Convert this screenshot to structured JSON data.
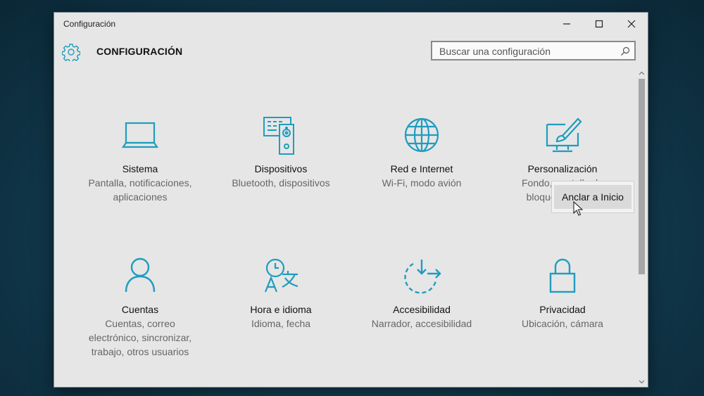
{
  "window": {
    "title": "Configuración",
    "controls": {
      "minimize": "minimize",
      "maximize": "maximize",
      "close": "close"
    }
  },
  "header": {
    "title": "CONFIGURACIÓN",
    "search_placeholder": "Buscar una configuración"
  },
  "accent_color": "#1e9dbf",
  "categories": [
    {
      "name": "Sistema",
      "desc_lines": [
        "Pantalla, notificaciones,",
        "aplicaciones"
      ],
      "icon": "laptop-icon"
    },
    {
      "name": "Dispositivos",
      "desc_lines": [
        "Bluetooth, dispositivos"
      ],
      "icon": "devices-icon"
    },
    {
      "name": "Red e Internet",
      "desc_lines": [
        "Wi-Fi, modo avión"
      ],
      "icon": "globe-icon"
    },
    {
      "name": "Personalización",
      "desc_lines": [
        "Fondo, pantalla de",
        "bloqueo, colores"
      ],
      "icon": "paintbrush-icon"
    },
    {
      "name": "Cuentas",
      "desc_lines": [
        "Cuentas, correo",
        "electrónico, sincronizar,",
        "trabajo, otros usuarios"
      ],
      "icon": "person-icon"
    },
    {
      "name": "Hora e idioma",
      "desc_lines": [
        "Idioma, fecha"
      ],
      "icon": "time-language-icon"
    },
    {
      "name": "Accesibilidad",
      "desc_lines": [
        "Narrador, accesibilidad"
      ],
      "icon": "accessibility-icon"
    },
    {
      "name": "Privacidad",
      "desc_lines": [
        "Ubicación, cámara"
      ],
      "icon": "lock-icon"
    }
  ],
  "context_menu": {
    "item": "Anclar a Inicio"
  }
}
